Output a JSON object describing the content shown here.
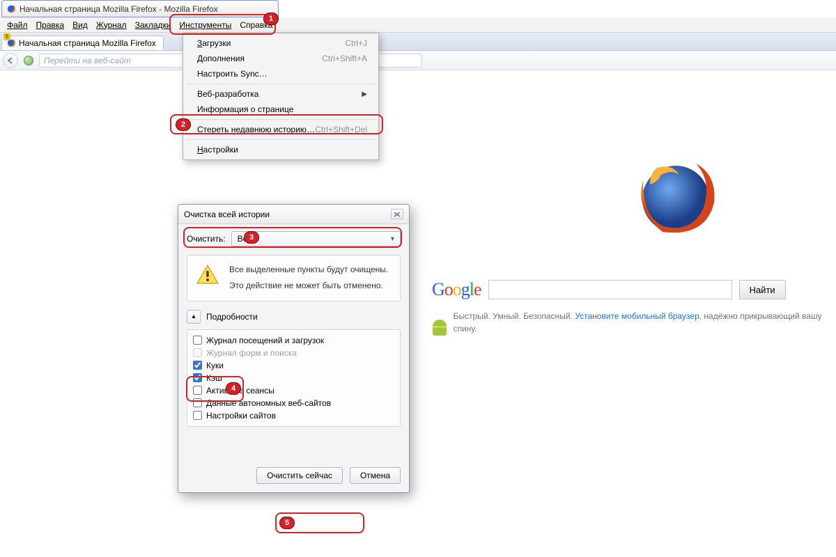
{
  "window": {
    "title": "Начальная страница Mozilla Firefox - Mozilla Firefox"
  },
  "menubar": {
    "file": "Файл",
    "edit": "Правка",
    "view": "Вид",
    "history": "Журнал",
    "bookmarks": "Закладки",
    "tools": "Инструменты",
    "help": "Справка"
  },
  "tab": {
    "title": "Начальная страница Mozilla Firefox",
    "badge": "5"
  },
  "address": {
    "placeholder": "Перейти на веб-сайт"
  },
  "tools_menu": {
    "downloads": {
      "label": "Загрузки",
      "shortcut": "Ctrl+J"
    },
    "addons": {
      "label": "Дополнения",
      "shortcut": "Ctrl+Shift+A"
    },
    "sync": {
      "label": "Настроить Sync…"
    },
    "webdev": {
      "label": "Веб-разработка"
    },
    "pageinfo": {
      "label": "Информация о странице"
    },
    "clearhist": {
      "label": "Стереть недавнюю историю…",
      "shortcut": "Ctrl+Shift+Del"
    },
    "settings": {
      "label": "Настройки"
    }
  },
  "dialog": {
    "title": "Очистка всей истории",
    "clear_label": "Очистить:",
    "clear_value": "Всё",
    "warn1": "Все выделенные пункты будут очищены.",
    "warn2": "Это действие не может быть отменено.",
    "details": "Подробности",
    "items": {
      "visits": "Журнал посещений и загрузок",
      "forms": "Журнал форм и поиска",
      "cookies": "Куки",
      "cache": "Кэш",
      "sessions": "Активные сеансы",
      "offline": "Данные автономных веб-сайтов",
      "sitesettings": "Настройки сайтов"
    },
    "ok": "Очистить сейчас",
    "cancel": "Отмена"
  },
  "search": {
    "button": "Найти"
  },
  "promo": {
    "text1": "Быстрый. Умный. Безопасный. ",
    "link": "Установите мобильный браузер",
    "text2": ", надёжно прикрывающий вашу спину."
  },
  "callouts": {
    "n1": "1",
    "n2": "2",
    "n3": "3",
    "n4": "4",
    "n5": "5"
  }
}
